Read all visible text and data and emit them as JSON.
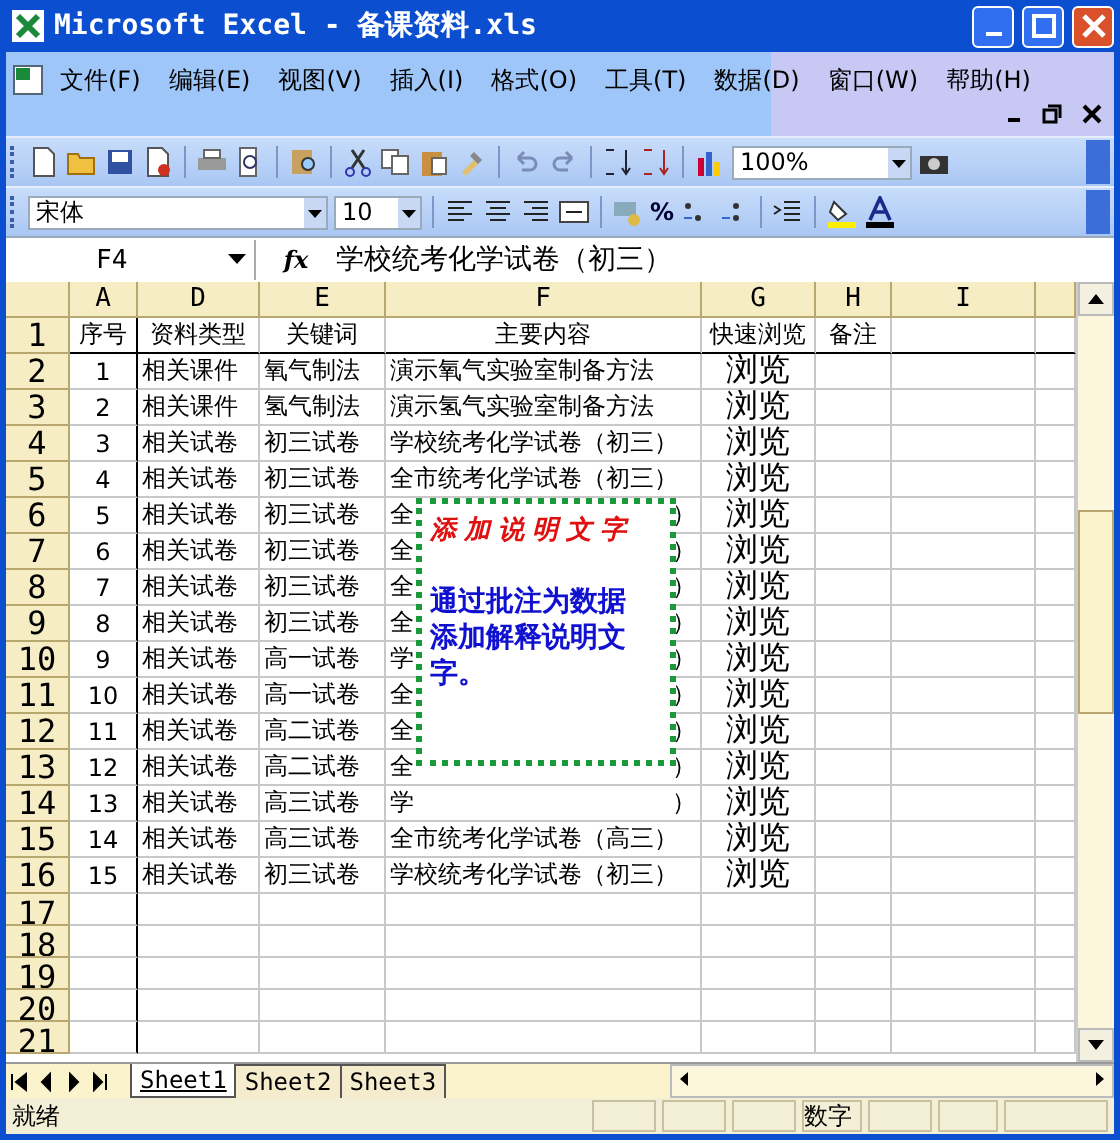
{
  "window": {
    "title": "Microsoft Excel - 备课资料.xls"
  },
  "menu": [
    "文件(F)",
    "编辑(E)",
    "视图(V)",
    "插入(I)",
    "格式(O)",
    "工具(T)",
    "数据(D)",
    "窗口(W)",
    "帮助(H)"
  ],
  "toolbar": {
    "zoom": "100%",
    "font": "宋体",
    "font_size": "10",
    "percent": "%"
  },
  "formula_bar": {
    "name_box": "F4",
    "fx": "fx",
    "formula": "学校统考化学试卷（初三）"
  },
  "columns": [
    "A",
    "D",
    "E",
    "F",
    "G",
    "H",
    "I"
  ],
  "rows": [
    {
      "kind": "header",
      "row": "1",
      "a": "序号",
      "d": "资料类型",
      "e": "关键词",
      "f": "主要内容",
      "g": "快速浏览",
      "h": "备注"
    },
    {
      "kind": "data",
      "row": "2",
      "a": "1",
      "d": "相关课件",
      "e": "氧气制法",
      "f": "演示氧气实验室制备方法",
      "g": "浏览"
    },
    {
      "kind": "data",
      "row": "3",
      "a": "2",
      "d": "相关课件",
      "e": "氢气制法",
      "f": "演示氢气实验室制备方法",
      "g": "浏览"
    },
    {
      "kind": "data",
      "row": "4",
      "a": "3",
      "d": "相关试卷",
      "e": "初三试卷",
      "f": "学校统考化学试卷（初三）",
      "g": "浏览"
    },
    {
      "kind": "data",
      "row": "5",
      "a": "4",
      "d": "相关试卷",
      "e": "初三试卷",
      "f": "全市统考化学试卷（初三）",
      "g": "浏览"
    },
    {
      "kind": "data",
      "row": "6",
      "a": "5",
      "d": "相关试卷",
      "e": "初三试卷",
      "f": "全",
      "f_tail": "）",
      "g": "浏览"
    },
    {
      "kind": "data",
      "row": "7",
      "a": "6",
      "d": "相关试卷",
      "e": "初三试卷",
      "f": "全",
      "f_tail": "）",
      "g": "浏览"
    },
    {
      "kind": "data",
      "row": "8",
      "a": "7",
      "d": "相关试卷",
      "e": "初三试卷",
      "f": "全",
      "f_tail": "）",
      "g": "浏览"
    },
    {
      "kind": "data",
      "row": "9",
      "a": "8",
      "d": "相关试卷",
      "e": "初三试卷",
      "f": "全",
      "f_tail": "）",
      "g": "浏览"
    },
    {
      "kind": "data",
      "row": "10",
      "a": "9",
      "d": "相关试卷",
      "e": "高一试卷",
      "f": "学",
      "f_tail": "）",
      "g": "浏览"
    },
    {
      "kind": "data",
      "row": "11",
      "a": "10",
      "d": "相关试卷",
      "e": "高一试卷",
      "f": "全",
      "f_tail": "）",
      "g": "浏览"
    },
    {
      "kind": "data",
      "row": "12",
      "a": "11",
      "d": "相关试卷",
      "e": "高二试卷",
      "f": "全",
      "f_tail": "）",
      "g": "浏览"
    },
    {
      "kind": "data",
      "row": "13",
      "a": "12",
      "d": "相关试卷",
      "e": "高二试卷",
      "f": "全",
      "f_tail": "）",
      "g": "浏览"
    },
    {
      "kind": "data",
      "row": "14",
      "a": "13",
      "d": "相关试卷",
      "e": "高三试卷",
      "f": "学",
      "f_tail": "）",
      "g": "浏览"
    },
    {
      "kind": "data",
      "row": "15",
      "a": "14",
      "d": "相关试卷",
      "e": "高三试卷",
      "f": "全市统考化学试卷（高三）",
      "g": "浏览"
    },
    {
      "kind": "data",
      "row": "16",
      "a": "15",
      "d": "相关试卷",
      "e": "初三试卷",
      "f": "学校统考化学试卷（初三）",
      "g": "浏览"
    },
    {
      "kind": "empty",
      "row": "17"
    },
    {
      "kind": "empty",
      "row": "18"
    },
    {
      "kind": "empty",
      "row": "19"
    },
    {
      "kind": "empty",
      "row": "20"
    },
    {
      "kind": "cut",
      "row": "21"
    }
  ],
  "comment": {
    "title": "添加说明文字",
    "body": "通过批注为数据添加解释说明文字。"
  },
  "sheet_tabs": [
    {
      "label": "Sheet1",
      "selected": true
    },
    {
      "label": "Sheet2",
      "selected": false
    },
    {
      "label": "Sheet3",
      "selected": false
    }
  ],
  "status_bar": {
    "status": "就绪",
    "mode": "数字"
  }
}
